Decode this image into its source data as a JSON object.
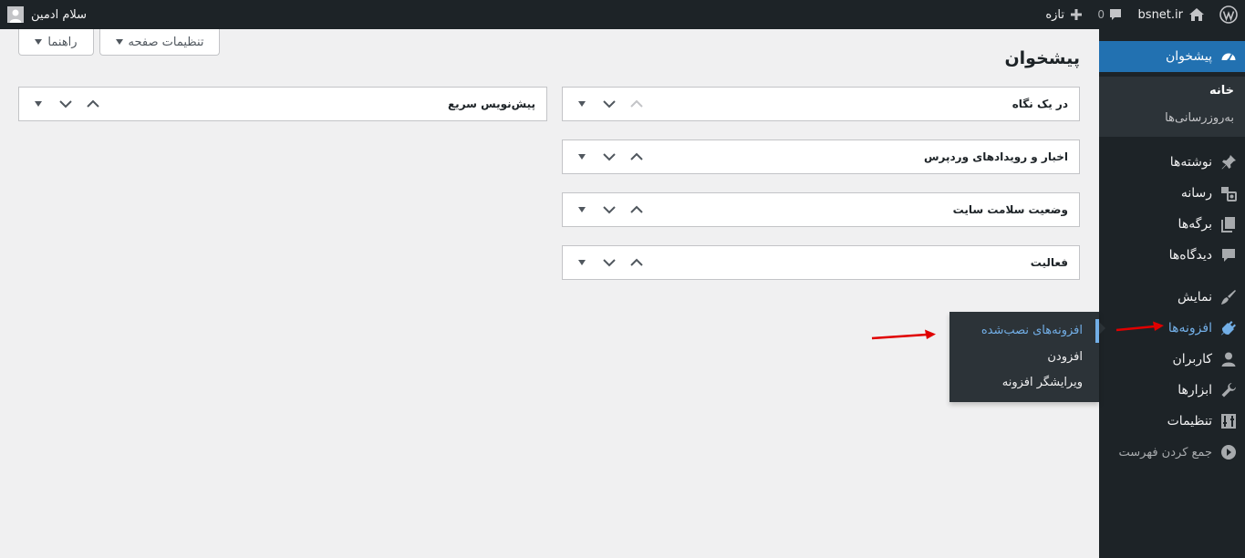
{
  "admin_bar": {
    "site_name": "bsnet.ir",
    "comments_count": "0",
    "new_label": "تازه",
    "greeting": "سلام ادمین"
  },
  "screen_meta": {
    "screen_options": "تنظیمات صفحه",
    "help": "راهنما"
  },
  "page_title": "پیشخوان",
  "sidebar": {
    "dashboard": "پیشخوان",
    "dashboard_sub": [
      "خانه",
      "به‌روزرسانی‌ها"
    ],
    "items": [
      {
        "label": "نوشته‌ها",
        "icon": "pin-icon"
      },
      {
        "label": "رسانه",
        "icon": "media-icon"
      },
      {
        "label": "برگه‌ها",
        "icon": "pages-icon"
      },
      {
        "label": "دیدگاه‌ها",
        "icon": "comments-icon"
      },
      {
        "label": "نمایش",
        "icon": "appearance-icon"
      },
      {
        "label": "افزونه‌ها",
        "icon": "plugins-icon"
      },
      {
        "label": "کاربران",
        "icon": "users-icon"
      },
      {
        "label": "ابزارها",
        "icon": "tools-icon"
      },
      {
        "label": "تنظیمات",
        "icon": "settings-icon"
      }
    ],
    "collapse": "جمع کردن فهرست"
  },
  "plugins_flyout": [
    "افزونه‌های نصب‌شده",
    "افزودن",
    "ویرایشگر افزونه"
  ],
  "widgets": {
    "right_column": [
      "در یک نگاه",
      "اخبار و رویدادهای وردپرس",
      "وضعیت سلامت سایت",
      "فعالیت"
    ],
    "left_column": [
      "پیش‌نویس سریع"
    ]
  },
  "colors": {
    "admin_bar": "#1d2327",
    "sidebar": "#1d2327",
    "accent": "#2271b1",
    "highlight": "#72aee6",
    "annotation": "#e00000"
  }
}
